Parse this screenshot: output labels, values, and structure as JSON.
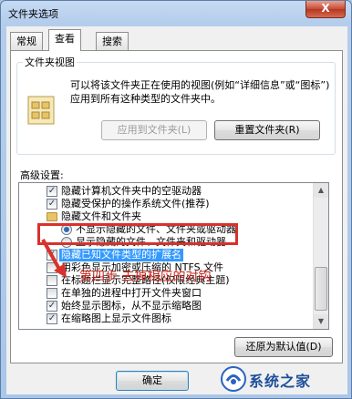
{
  "window": {
    "title": "文件夹选项",
    "close_label": "X"
  },
  "tabs": [
    {
      "label": "常规"
    },
    {
      "label": "查看"
    },
    {
      "label": "搜索"
    }
  ],
  "folder_views": {
    "legend": "文件夹视图",
    "description": "可以将该文件夹正在使用的视图(例如“详细信息”或“图标”)应用到所有这种类型的文件夹中。",
    "apply_button": "应用到文件夹(L)",
    "reset_button": "重置文件夹(R)"
  },
  "advanced": {
    "label": "高级设置:",
    "items": [
      {
        "kind": "checkbox",
        "checked": true,
        "label": "隐藏计算机文件夹中的空驱动器"
      },
      {
        "kind": "checkbox",
        "checked": true,
        "label": "隐藏受保护的操作系统文件(推荐)"
      },
      {
        "kind": "folder",
        "label": "隐藏文件和文件夹"
      },
      {
        "kind": "radio",
        "checked": true,
        "label": "不显示隐藏的文件、文件夹或驱动器"
      },
      {
        "kind": "radio",
        "checked": false,
        "label": "显示隐藏的文件、文件夹和驱动器"
      },
      {
        "kind": "checkbox",
        "checked": true,
        "label": "隐藏已知文件类型的扩展名"
      },
      {
        "kind": "checkbox",
        "checked": false,
        "label": "用彩色显示加密或压缩的 NTFS 文件"
      },
      {
        "kind": "checkbox",
        "checked": false,
        "label": "在标题栏显示完整路径(仅限经典主题)"
      },
      {
        "kind": "checkbox",
        "checked": false,
        "label": "在单独的进程中打开文件夹窗口"
      },
      {
        "kind": "checkbox",
        "checked": true,
        "label": "始终显示图标，从不显示缩略图"
      },
      {
        "kind": "checkbox",
        "checked": true,
        "label": "在缩略图上显示文件图标"
      },
      {
        "kind": "checkbox",
        "checked": true,
        "label": "在文件夹提示中显示文件大小信息"
      },
      {
        "kind": "checkbox",
        "checked": true,
        "label": "在预览窗格中显示预览句柄"
      }
    ],
    "selected_index": 5,
    "restore_button": "还原为默认值(D)"
  },
  "annotation": {
    "caption": "第四步 去掉相应的对钩"
  },
  "footer": {
    "ok_button": "确定"
  },
  "watermark": {
    "text": "系统之家"
  },
  "colors": {
    "annotation_red": "#d9312b",
    "selection_blue": "#3399ff"
  }
}
